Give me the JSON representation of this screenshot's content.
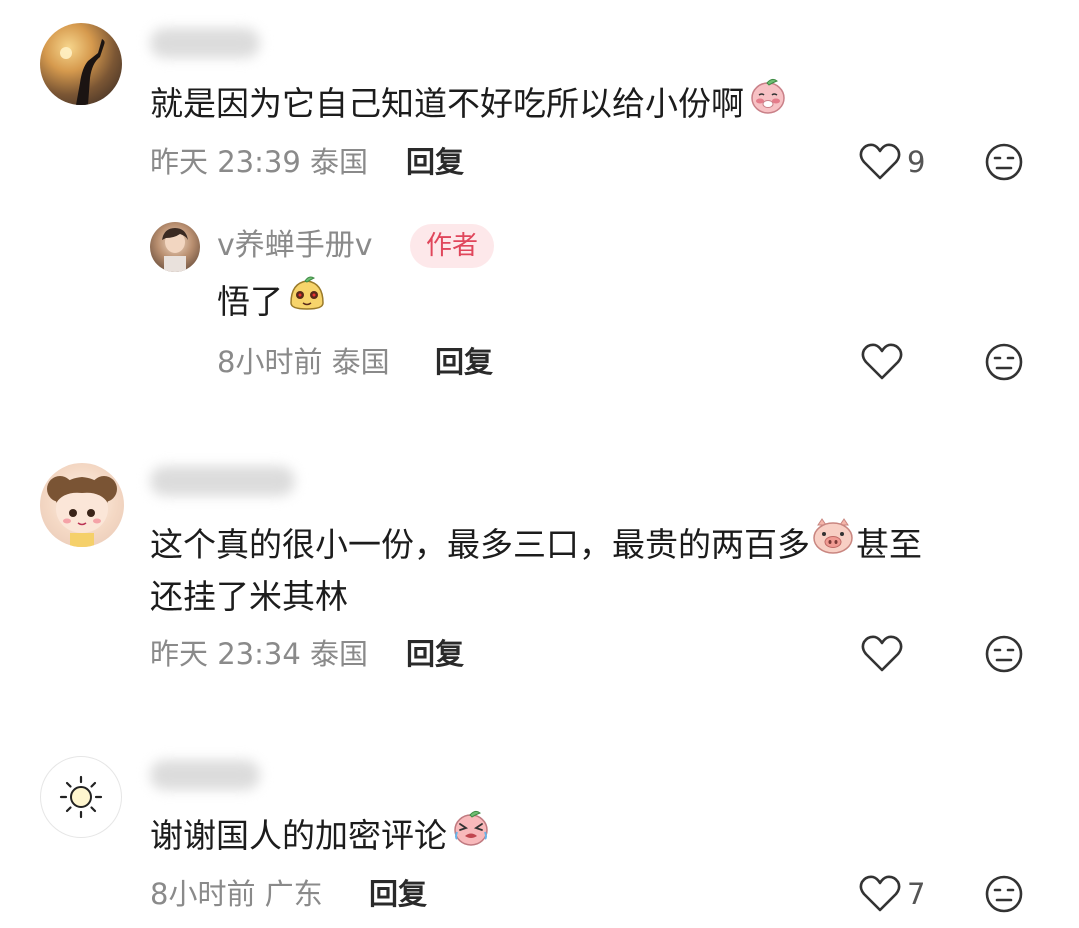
{
  "comments": [
    {
      "text": "就是因为它自己知道不好吃所以给小份啊",
      "time": "昨天 23:39",
      "location": "泰国",
      "reply_label": "回复",
      "likes": "9",
      "reply": {
        "author": "v养蝉手册v",
        "badge": "作者",
        "text": "悟了",
        "time": "8小时前",
        "location": "泰国",
        "reply_label": "回复"
      }
    },
    {
      "text_line1": "这个真的很小一份，最多三口，最贵的两百多",
      "text_line1_tail": "甚至",
      "text_line2": "还挂了米其林",
      "time": "昨天 23:34",
      "location": "泰国",
      "reply_label": "回复"
    },
    {
      "text": "谢谢国人的加密评论",
      "time": "8小时前",
      "location": "广东",
      "reply_label": "回复",
      "likes": "7"
    }
  ],
  "icons": {
    "like": "heart-outline-icon",
    "dislike": "neutral-face-icon",
    "emoji1": "blushing-peach-emoji",
    "emoji2": "yellow-bun-emoji",
    "emoji3": "pig-face-emoji",
    "emoji4": "crying-peach-emoji"
  },
  "colors": {
    "meta_gray": "#8a8a8a",
    "badge_bg": "#fde8ea",
    "badge_text": "#e0465b"
  }
}
